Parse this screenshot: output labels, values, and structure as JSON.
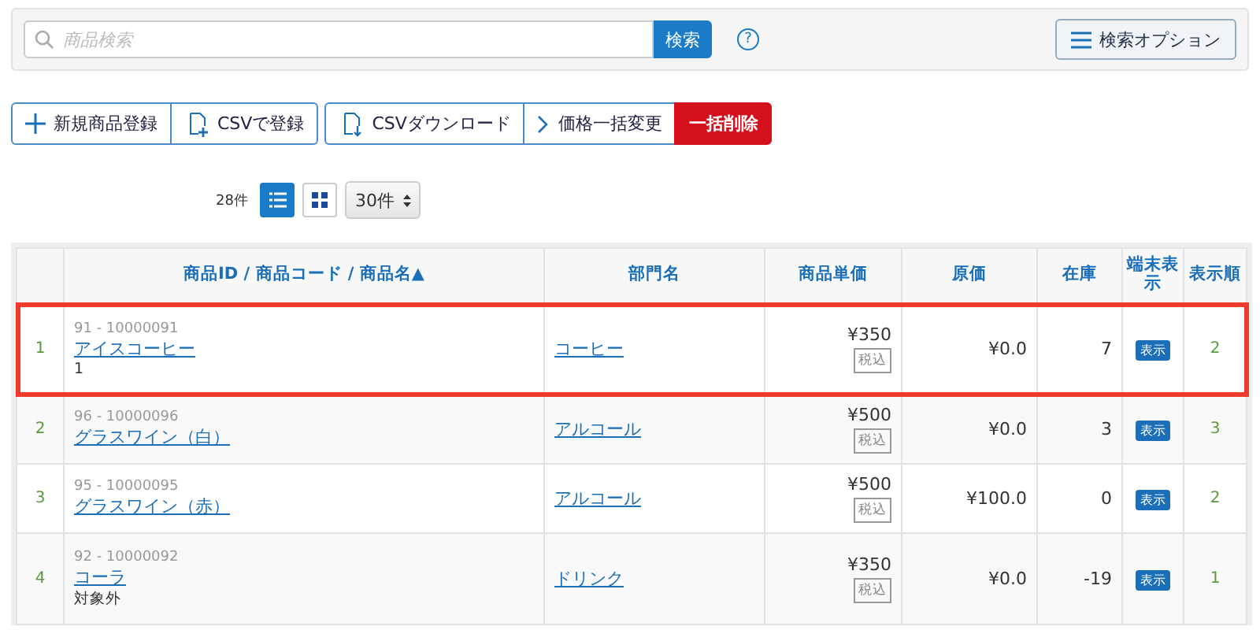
{
  "search": {
    "placeholder": "商品検索",
    "button": "検索",
    "help": "?",
    "options_button": "検索オプション"
  },
  "action_groups": [
    [
      {
        "kind": "plus",
        "label": "新規商品登録"
      },
      {
        "kind": "upload",
        "label": "CSVで登録"
      }
    ],
    [
      {
        "kind": "download",
        "label": "CSVダウンロード"
      },
      {
        "kind": "chevron",
        "label": "価格一括変更"
      },
      {
        "kind": "danger",
        "label": "一括削除"
      }
    ]
  ],
  "list_controls": {
    "count": "28件",
    "views": [
      {
        "kind": "list",
        "selected": true
      },
      {
        "kind": "grid",
        "selected": false
      }
    ],
    "per_page": "30件"
  },
  "table": {
    "columns": [
      "",
      "商品ID / 商品コード / 商品名▲",
      "部門名",
      "商品単価",
      "原価",
      "在庫",
      "端末表示",
      "表示順"
    ],
    "rows": [
      {
        "index": "1",
        "id_code": "91 - 10000091",
        "name": "アイスコーヒー",
        "note": "1",
        "department": "コーヒー",
        "price": "¥350",
        "tax": "税込",
        "cost": "¥0.0",
        "stock": "7",
        "terminal": "表示",
        "order": "2",
        "highlighted": true
      },
      {
        "index": "2",
        "id_code": "96 - 10000096",
        "name": "グラスワイン（白）",
        "department": "アルコール",
        "price": "¥500",
        "tax": "税込",
        "cost": "¥0.0",
        "stock": "3",
        "terminal": "表示",
        "order": "3",
        "highlighted": false
      },
      {
        "index": "3",
        "id_code": "95 - 10000095",
        "name": "グラスワイン（赤）",
        "department": "アルコール",
        "price": "¥500",
        "tax": "税込",
        "cost": "¥100.0",
        "stock": "0",
        "terminal": "表示",
        "order": "2",
        "highlighted": false
      },
      {
        "index": "4",
        "id_code": "92 - 10000092",
        "name": "コーラ",
        "note": "対象外",
        "department": "ドリンク",
        "price": "¥350",
        "tax": "税込",
        "cost": "¥0.0",
        "stock": "-19",
        "terminal": "表示",
        "order": "1",
        "highlighted": false
      }
    ]
  }
}
